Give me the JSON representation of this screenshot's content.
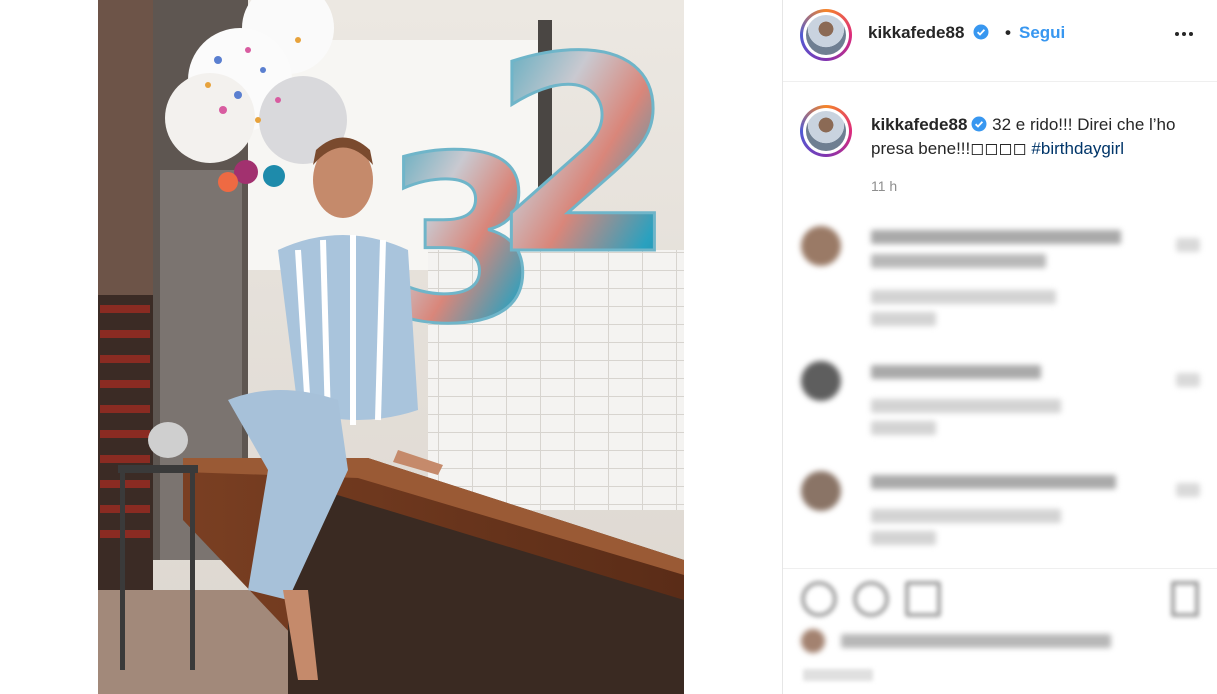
{
  "post": {
    "username": "kikkafede88",
    "follow_label": "Segui",
    "separator": "•",
    "caption": "32 e rido!!! Direi che l’ho presa bene!!!◻◻◻◻",
    "hashtag": "#birthdaygirl",
    "time": "11 h"
  },
  "photo": {
    "balloon_digits": "32"
  },
  "colors": {
    "link": "#3897f0",
    "hashtag": "#003569",
    "text": "#262626",
    "muted": "#8e8e8e",
    "verified": "#3897f0"
  },
  "icons": {
    "verified": "verified-badge-icon",
    "more": "more-options-icon",
    "like": "heart-icon",
    "comment": "comment-icon",
    "share": "share-icon",
    "save": "bookmark-icon"
  }
}
